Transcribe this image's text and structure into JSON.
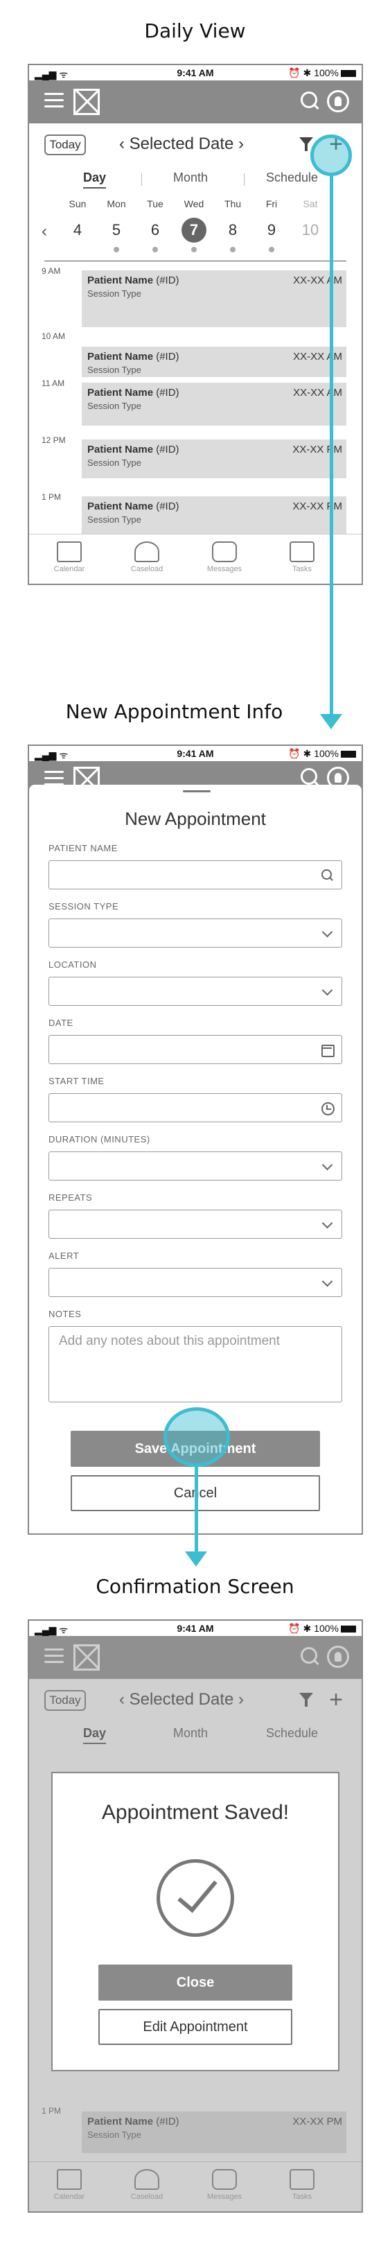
{
  "sections": {
    "daily": "Daily View",
    "new_appt": "New Appointment Info",
    "confirm": "Confirmation Screen"
  },
  "status": {
    "time": "9:41 AM",
    "battery": "100%"
  },
  "colors": {
    "highlight": "#3cbdd1",
    "navbar": "#8a8a8a",
    "appt_fill": "#dcdcdc"
  },
  "daily": {
    "today": "Today",
    "selected_date": "Selected Date",
    "tabs": [
      "Day",
      "Month",
      "Schedule"
    ],
    "days": [
      {
        "name": "Sun",
        "date": "4"
      },
      {
        "name": "Mon",
        "date": "5"
      },
      {
        "name": "Tue",
        "date": "6"
      },
      {
        "name": "Wed",
        "date": "7"
      },
      {
        "name": "Thu",
        "date": "8"
      },
      {
        "name": "Fri",
        "date": "9"
      },
      {
        "name": "Sat",
        "date": "10"
      }
    ],
    "appointments": [
      {
        "time": "9 AM",
        "name": "Patient Name",
        "id": "(#ID)",
        "type": "Session Type",
        "range": "XX-XX AM"
      },
      {
        "time": "10 AM",
        "name": "Patient Name",
        "id": "(#ID)",
        "type": "Session Type",
        "range": "XX-XX AM"
      },
      {
        "time": "11 AM",
        "name": "Patient Name",
        "id": "(#ID)",
        "type": "Session Type",
        "range": "XX-XX AM"
      },
      {
        "time": "12 PM",
        "name": "Patient Name",
        "id": "(#ID)",
        "type": "Session Type",
        "range": "XX-XX PM"
      },
      {
        "time": "1 PM",
        "name": "Patient Name",
        "id": "(#ID)",
        "type": "Session Type",
        "range": "XX-XX PM"
      }
    ],
    "tabbar": [
      "Calendar",
      "Caseload",
      "Messages",
      "Tasks"
    ]
  },
  "form": {
    "title": "New Appointment",
    "fields": {
      "patient": "PATIENT NAME",
      "session": "SESSION TYPE",
      "location": "LOCATION",
      "date": "DATE",
      "start": "START TIME",
      "duration": "DURATION (MINUTES)",
      "repeats": "REPEATS",
      "alert": "ALERT",
      "notes": "NOTES"
    },
    "notes_placeholder": "Add any notes about this appointment",
    "save": "Save Appointment",
    "cancel": "Cancel"
  },
  "confirm": {
    "title": "Appointment Saved!",
    "close": "Close",
    "edit": "Edit Appointment",
    "appt_time": "1 PM",
    "appt_name": "Patient Name",
    "appt_id": "(#ID)",
    "appt_type": "Session Type",
    "appt_range": "XX-XX PM"
  }
}
